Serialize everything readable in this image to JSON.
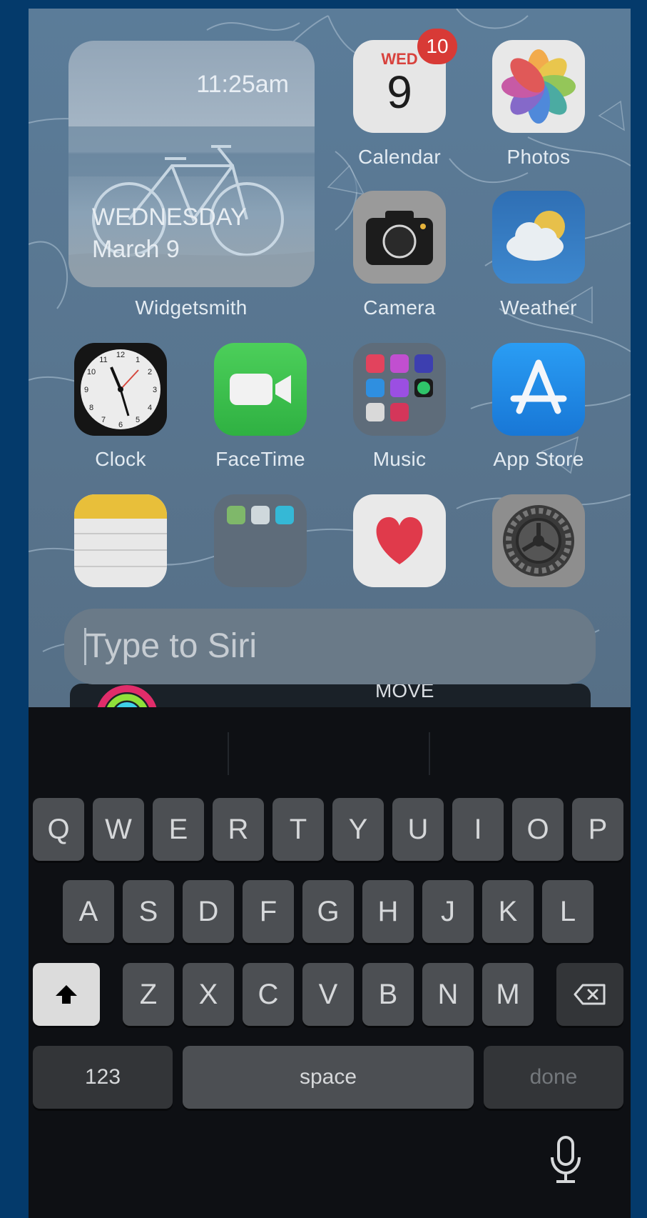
{
  "home": {
    "widget": {
      "time": "11:25am",
      "day": "WEDNESDAY",
      "date": "March 9",
      "label": "Widgetsmith"
    },
    "calendar": {
      "weekday": "WED",
      "day": "9",
      "badge": "10",
      "label": "Calendar"
    },
    "apps": {
      "photos": "Photos",
      "camera": "Camera",
      "weather": "Weather",
      "clock": "Clock",
      "facetime": "FaceTime",
      "music": "Music",
      "appstore": "App Store"
    }
  },
  "siri": {
    "placeholder": "Type to Siri",
    "suggestion": "MOVE"
  },
  "keyboard": {
    "row1": [
      "Q",
      "W",
      "E",
      "R",
      "T",
      "Y",
      "U",
      "I",
      "O",
      "P"
    ],
    "row2": [
      "A",
      "S",
      "D",
      "F",
      "G",
      "H",
      "J",
      "K",
      "L"
    ],
    "row3": [
      "Z",
      "X",
      "C",
      "V",
      "B",
      "N",
      "M"
    ],
    "numbers_label": "123",
    "space_label": "space",
    "done_label": "done"
  },
  "colors": {
    "backdrop": "#043a6b",
    "wallpaper": "#5a7b97",
    "badge": "#d83a36",
    "key": "#4c4f53",
    "keyboard": "#0e1014"
  }
}
